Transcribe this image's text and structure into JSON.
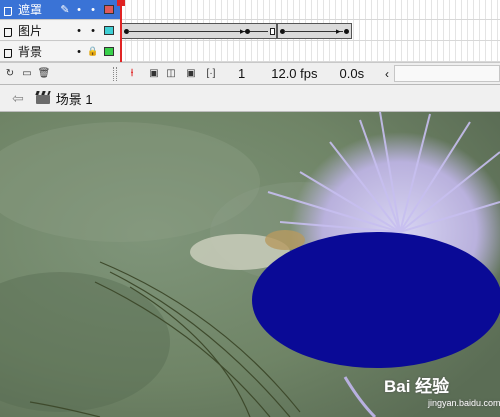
{
  "timeline": {
    "layers": [
      {
        "name": "遮罩",
        "selected": true,
        "edit_icon": "pencil-icon",
        "visible_mark": "•",
        "lock_mark": "•",
        "outline_color": "#e05a5a"
      },
      {
        "name": "图片",
        "selected": false,
        "edit_icon": "",
        "visible_mark": "•",
        "lock_mark": "•",
        "outline_color": "#3fcfd4"
      },
      {
        "name": "背景",
        "selected": false,
        "edit_icon": "",
        "visible_mark": "•",
        "lock_mark": "lock-icon",
        "outline_color": "#39d04b"
      }
    ],
    "current_frame": "1",
    "frame_rate": "12.0 fps",
    "elapsed_time": "0.0s"
  },
  "editbar": {
    "scene_label": "场景 1"
  },
  "stage": {
    "mask_fill_color": "#0a0a96"
  },
  "watermark": {
    "brand": "Bai 经验",
    "url": "jingyan.baidu.com"
  }
}
